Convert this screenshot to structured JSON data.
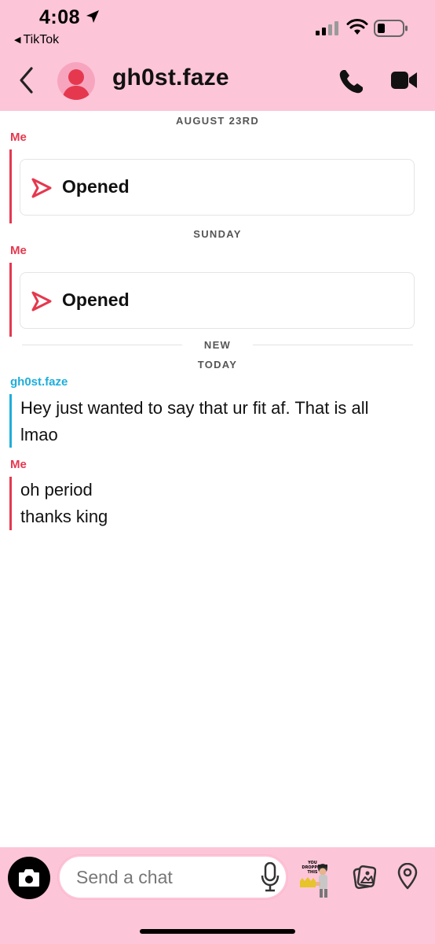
{
  "status_bar": {
    "time": "4:08",
    "back_app": "TikTok"
  },
  "header": {
    "title": "gh0st.faze"
  },
  "thread": {
    "dates": {
      "first": "AUGUST 23RD",
      "second": "SUNDAY",
      "new": "NEW",
      "today": "TODAY"
    },
    "snap1": {
      "sender": "Me",
      "label": "Opened"
    },
    "snap2": {
      "sender": "Me",
      "label": "Opened"
    },
    "message1": {
      "sender": "gh0st.faze",
      "line1": "Hey just wanted to say that ur fit af. That is all",
      "line2": "lmao"
    },
    "message2": {
      "sender": "Me",
      "line1": "oh period",
      "line2": "thanks king"
    }
  },
  "composer": {
    "placeholder": "Send a chat",
    "bitmoji_caption": "YOU DROPPED THIS"
  },
  "colors": {
    "header_bg": "#fdc5d8",
    "me": "#e5384f",
    "them": "#1eaedb"
  },
  "icons": [
    "location-arrow-icon",
    "cellular-signal-icon",
    "wifi-icon",
    "battery-icon",
    "chevron-left-icon",
    "avatar-icon",
    "phone-icon",
    "video-camera-icon",
    "snap-opened-icon",
    "camera-icon",
    "microphone-icon",
    "memories-icon",
    "map-pin-icon"
  ]
}
